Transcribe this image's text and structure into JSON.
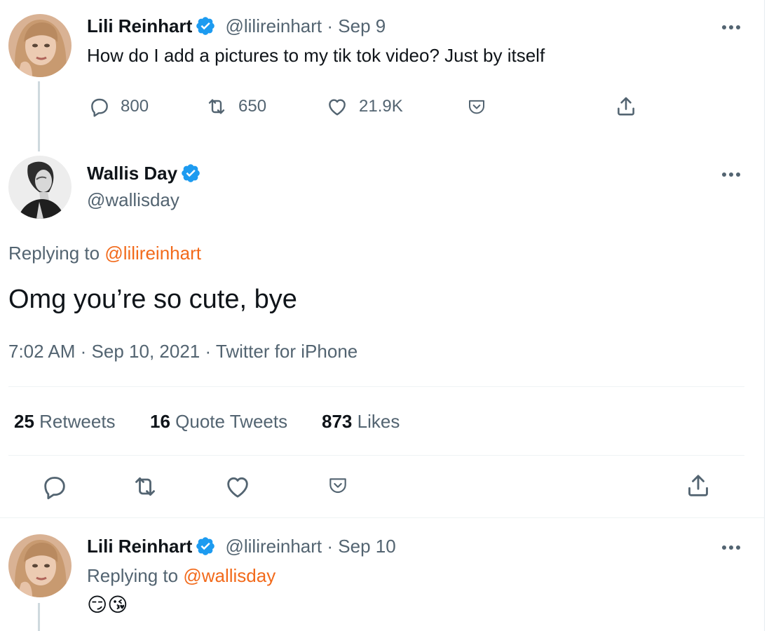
{
  "tweet1": {
    "name": "Lili Reinhart",
    "handle": "@lilireinhart",
    "sep": "·",
    "date": "Sep 9",
    "text": "How do I add a pictures to my tik tok video? Just by itself",
    "replies": "800",
    "retweets": "650",
    "likes": "21.9K"
  },
  "main": {
    "name": "Wallis Day",
    "handle": "@wallisday",
    "replying_prefix": "Replying to ",
    "replying_to": "@lilireinhart",
    "text": "Omg you’re so cute, bye",
    "time": "7:02 AM",
    "date": "Sep 10, 2021",
    "source": "Twitter for iPhone",
    "sep": "·",
    "stats": {
      "retweets_count": "25",
      "retweets_label": "Retweets",
      "quotes_count": "16",
      "quotes_label": "Quote Tweets",
      "likes_count": "873",
      "likes_label": "Likes"
    }
  },
  "tweet3": {
    "name": "Lili Reinhart",
    "handle": "@lilireinhart",
    "sep": "·",
    "date": "Sep 10",
    "replying_prefix": "Replying to ",
    "replying_to": "@wallisday",
    "text": "😏😘"
  },
  "colors": {
    "accent": "#f26a1b",
    "verified": "#1d9bf0",
    "secondary_text": "#536471",
    "divider": "#eff3f4"
  },
  "icons": [
    "reply-icon",
    "retweet-icon",
    "like-icon",
    "pocket-icon",
    "share-icon",
    "more-icon",
    "verified-icon"
  ]
}
